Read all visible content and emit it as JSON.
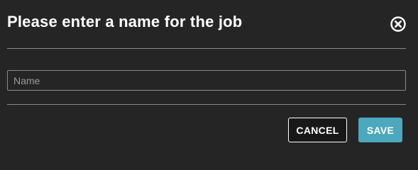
{
  "dialog": {
    "title": "Please enter a name for the job",
    "close_icon": "close-circle-icon",
    "name_input": {
      "value": "",
      "placeholder": "Name"
    },
    "buttons": {
      "cancel_label": "CANCEL",
      "save_label": "SAVE"
    }
  },
  "colors": {
    "background": "#252525",
    "accent": "#4ba8bd",
    "divider": "#8a8a8a"
  }
}
